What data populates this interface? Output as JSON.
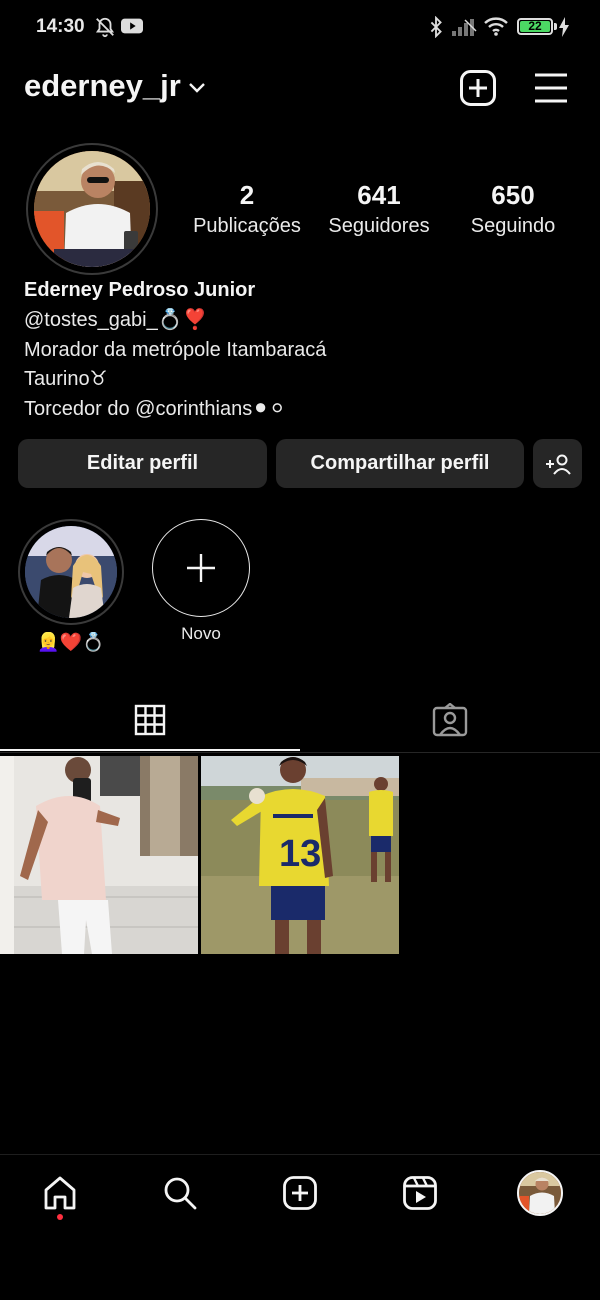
{
  "status_bar": {
    "time": "14:30",
    "battery_level": "22",
    "icons": [
      "bell-off-icon",
      "youtube-icon",
      "bluetooth-icon",
      "signal-icon",
      "wifi-icon",
      "battery-icon",
      "charging-icon"
    ]
  },
  "header": {
    "username": "ederney_jr",
    "icons": [
      "chevron-down-icon",
      "add-post-icon",
      "menu-icon"
    ]
  },
  "profile": {
    "stats": [
      {
        "value": "2",
        "label": "Publicações"
      },
      {
        "value": "641",
        "label": "Seguidores"
      },
      {
        "value": "650",
        "label": "Seguindo"
      }
    ],
    "name": "Ederney Pedroso Junior",
    "bio_lines": [
      "@tostes_gabi_💍❣️",
      "Morador da metrópole Itambaracá",
      "Taurino♉",
      "Torcedor do @corinthians⚫⚪"
    ]
  },
  "buttons": {
    "edit_profile": "Editar perfil",
    "share_profile": "Compartilhar perfil"
  },
  "highlights": [
    {
      "label": "👱‍♀️❤️💍"
    }
  ],
  "new_highlight_label": "Novo",
  "colors": {
    "background": "#000000",
    "button_bg": "#262626",
    "text": "#f5f5f5",
    "notification_dot": "#ff3040",
    "battery": "#4cd964"
  }
}
